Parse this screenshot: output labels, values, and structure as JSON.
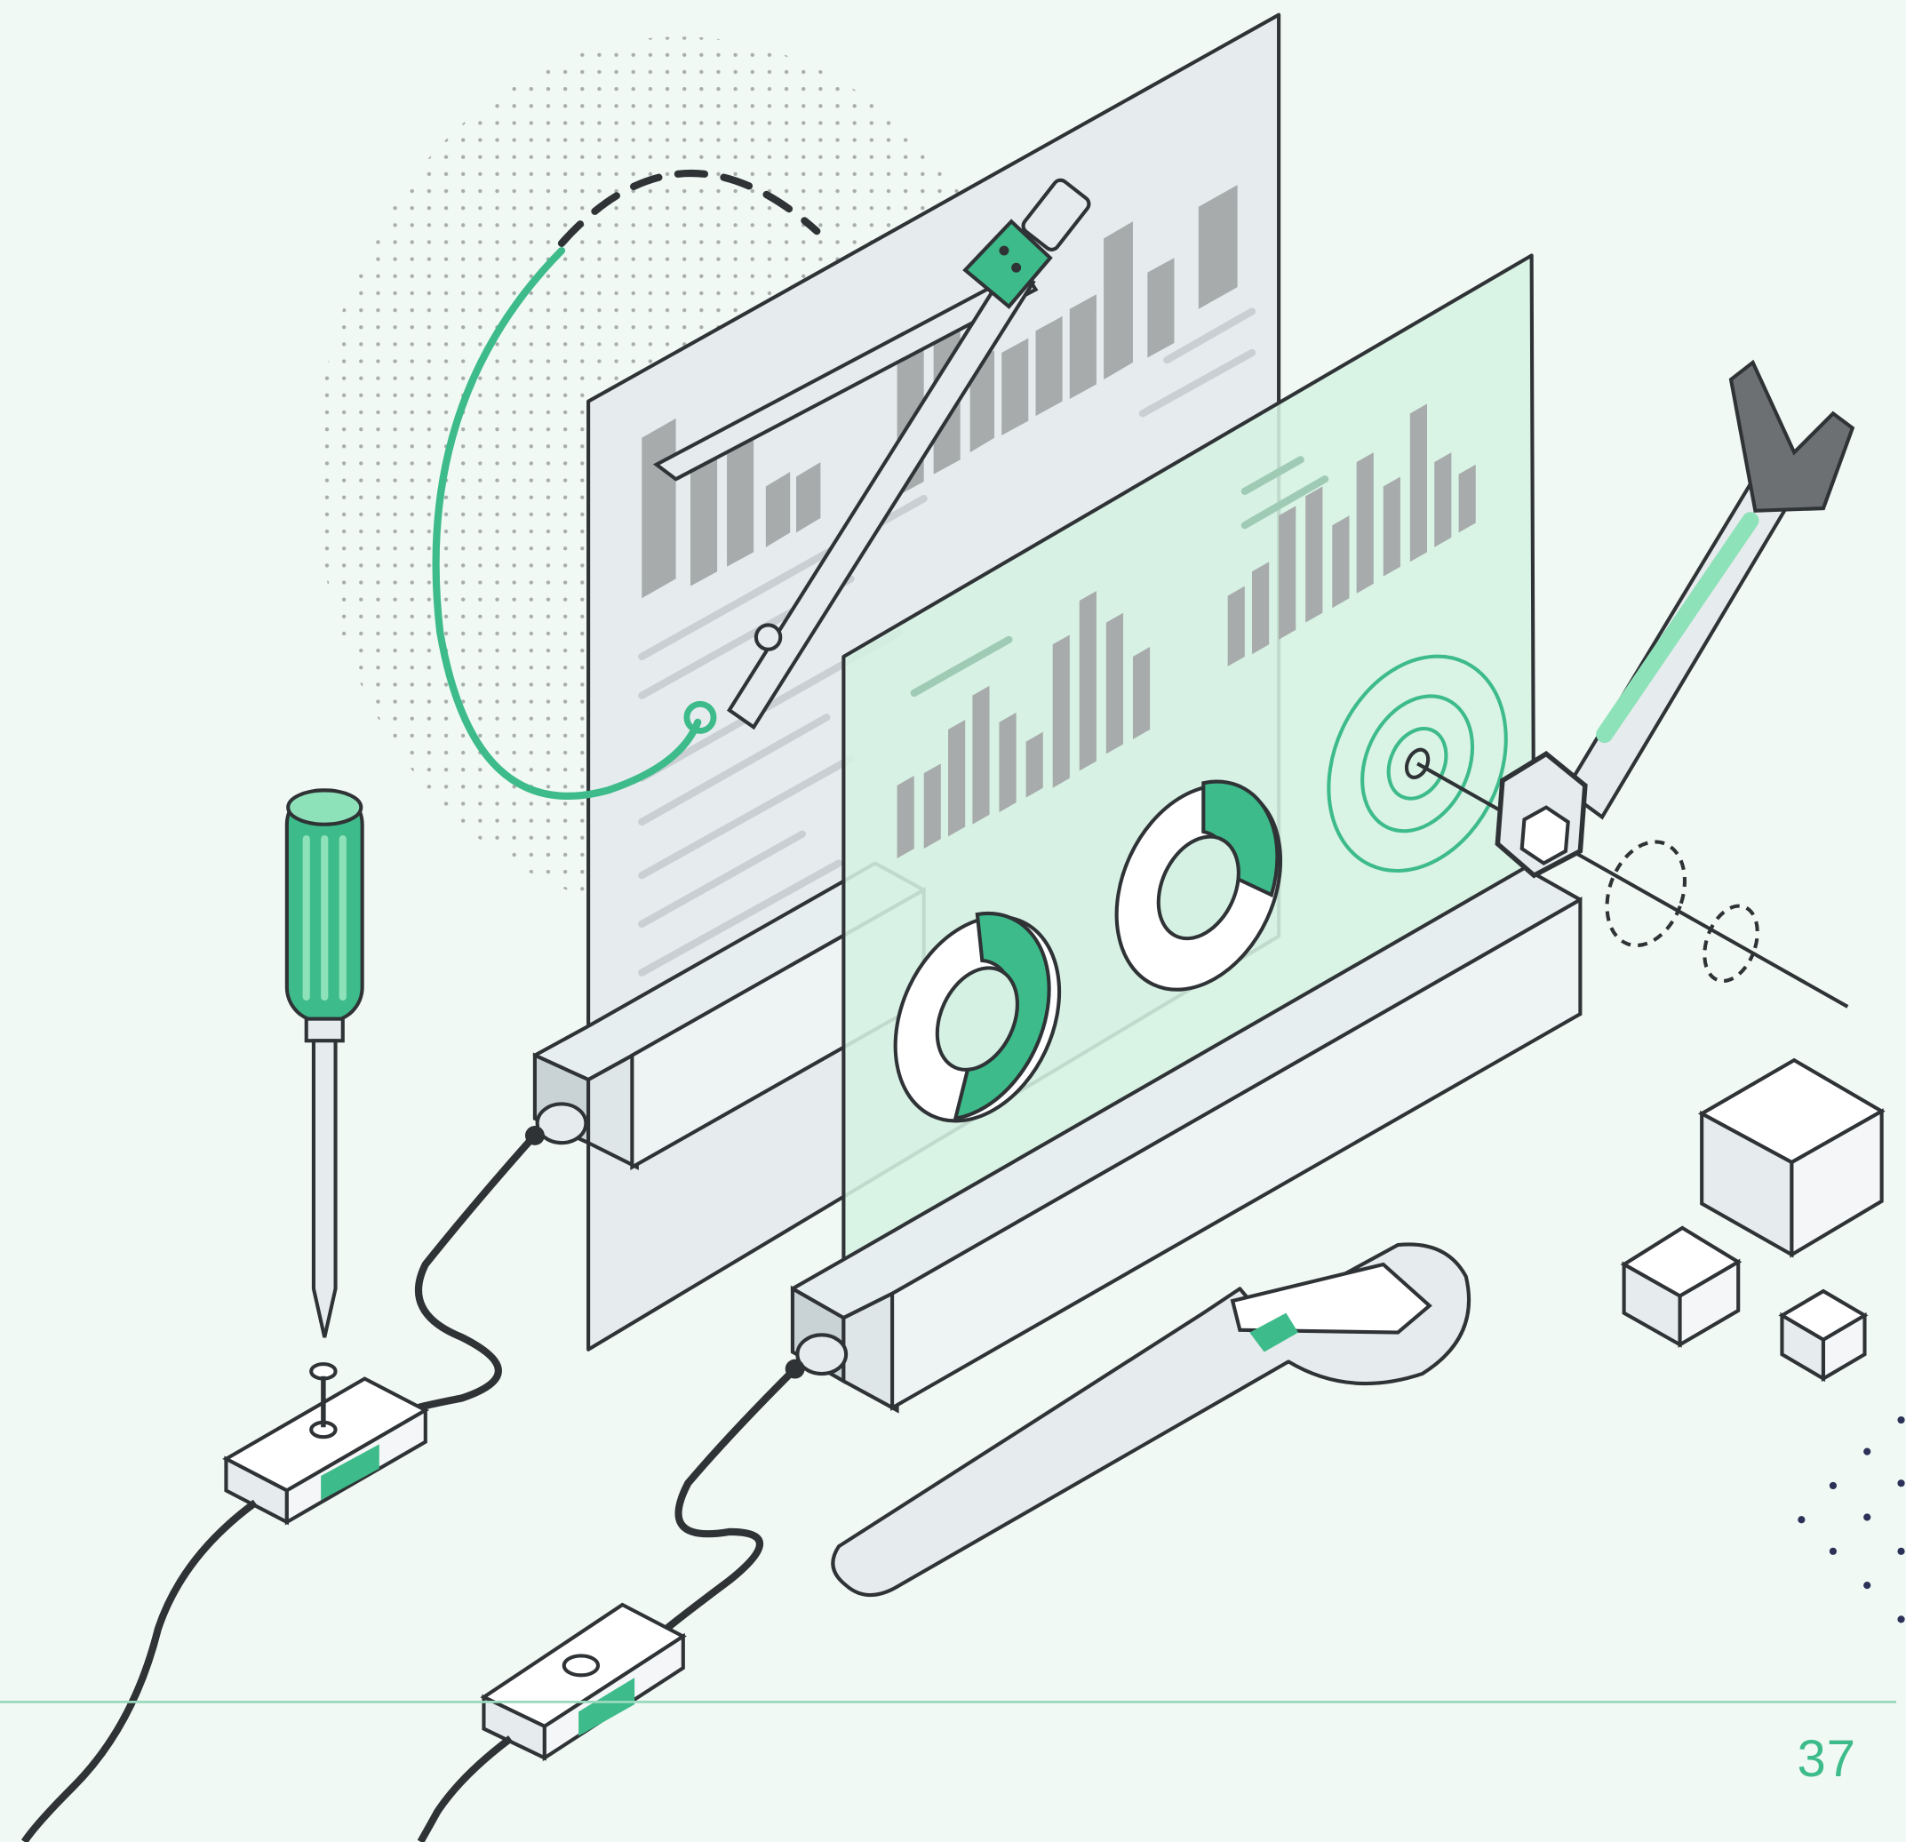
{
  "page": {
    "number": "37"
  },
  "palette": {
    "background": "#f1f9f4",
    "accent": "#3dbb8a",
    "outline": "#2f3336",
    "panel_back": "#e6ebed",
    "panel_front": "#d5f1e3",
    "bar_fill": "#a7abab",
    "divider": "#9ad9bd"
  },
  "illustration": {
    "icons": [
      "drafting-compass-icon",
      "screwdriver-icon",
      "open-end-wrench-icon",
      "adjustable-wrench-icon",
      "target-icon",
      "donut-chart-icon",
      "bar-chart-icon",
      "cube-icon",
      "cable-connector-icon"
    ]
  }
}
